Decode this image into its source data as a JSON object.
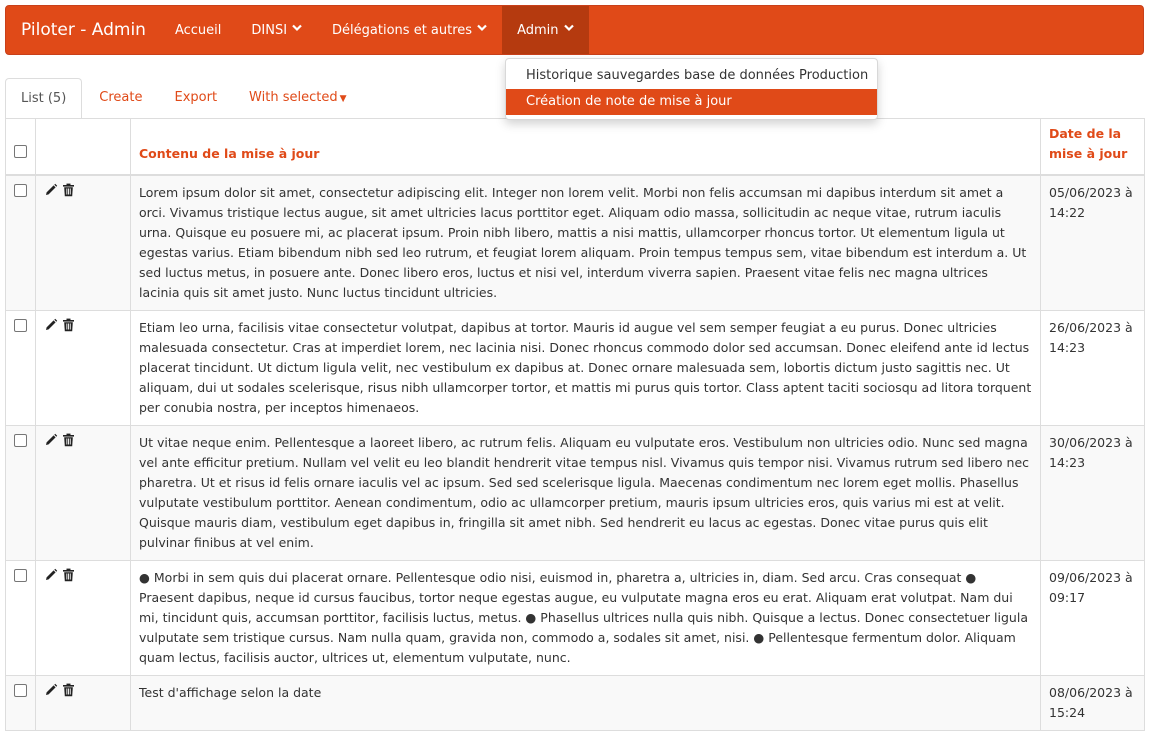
{
  "navbar": {
    "brand": "Piloter - Admin",
    "items": [
      {
        "label": "Accueil",
        "caret": false
      },
      {
        "label": "DINSI",
        "caret": true
      },
      {
        "label": "Délégations et autres",
        "caret": true
      },
      {
        "label": "Admin",
        "caret": true
      }
    ]
  },
  "admin_menu": {
    "items": [
      "Historique sauvegardes base de données Production",
      "Création de note de mise à jour"
    ]
  },
  "tabs": {
    "list": "List (5)",
    "create": "Create",
    "export": "Export",
    "with_selected": "With selected"
  },
  "table": {
    "headers": {
      "content": "Contenu de la mise à jour",
      "date_line1": "Date de la",
      "date_line2": "mise à jour"
    },
    "rows": [
      {
        "content": "Lorem ipsum dolor sit amet, consectetur adipiscing elit. Integer non lorem velit. Morbi non felis accumsan mi dapibus interdum sit amet a orci. Vivamus tristique lectus augue, sit amet ultricies lacus porttitor eget. Aliquam odio massa, sollicitudin ac neque vitae, rutrum iaculis urna. Quisque eu posuere mi, ac placerat ipsum. Proin nibh libero, mattis a nisi mattis, ullamcorper rhoncus tortor. Ut elementum ligula ut egestas varius. Etiam bibendum nibh sed leo rutrum, et feugiat lorem aliquam. Proin tempus tempus sem, vitae bibendum est interdum a. Ut sed luctus metus, in posuere ante. Donec libero eros, luctus et nisi vel, interdum viverra sapien. Praesent vitae felis nec magna ultrices lacinia quis sit amet justo. Nunc luctus tincidunt ultricies.",
        "date": "05/06/2023 à",
        "time": "14:22"
      },
      {
        "content": "Etiam leo urna, facilisis vitae consectetur volutpat, dapibus at tortor. Mauris id augue vel sem semper feugiat a eu purus. Donec ultricies malesuada consectetur. Cras at imperdiet lorem, nec lacinia nisi. Donec rhoncus commodo dolor sed accumsan. Donec eleifend ante id lectus placerat tincidunt. Ut dictum ligula velit, nec vestibulum ex dapibus at. Donec ornare malesuada sem, lobortis dictum justo sagittis nec. Ut aliquam, dui ut sodales scelerisque, risus nibh ullamcorper tortor, et mattis mi purus quis tortor. Class aptent taciti sociosqu ad litora torquent per conubia nostra, per inceptos himenaeos.",
        "date": "26/06/2023 à",
        "time": "14:23"
      },
      {
        "content": "Ut vitae neque enim. Pellentesque a laoreet libero, ac rutrum felis. Aliquam eu vulputate eros. Vestibulum non ultricies odio. Nunc sed magna vel ante efficitur pretium. Nullam vel velit eu leo blandit hendrerit vitae tempus nisl. Vivamus quis tempor nisi. Vivamus rutrum sed libero nec pharetra. Ut et risus id felis ornare iaculis vel ac ipsum. Sed sed scelerisque ligula. Maecenas condimentum nec lorem eget mollis. Phasellus vulputate vestibulum porttitor. Aenean condimentum, odio ac ullamcorper pretium, mauris ipsum ultricies eros, quis varius mi est at velit. Quisque mauris diam, vestibulum eget dapibus in, fringilla sit amet nibh. Sed hendrerit eu lacus ac egestas. Donec vitae purus quis elit pulvinar finibus at vel enim.",
        "date": "30/06/2023 à",
        "time": "14:23"
      },
      {
        "content": "● Morbi in sem quis dui placerat ornare. Pellentesque odio nisi, euismod in, pharetra a, ultricies in, diam. Sed arcu. Cras consequat ● Praesent dapibus, neque id cursus faucibus, tortor neque egestas augue, eu vulputate magna eros eu erat. Aliquam erat volutpat. Nam dui mi, tincidunt quis, accumsan porttitor, facilisis luctus, metus. ● Phasellus ultrices nulla quis nibh. Quisque a lectus. Donec consectetuer ligula vulputate sem tristique cursus. Nam nulla quam, gravida non, commodo a, sodales sit amet, nisi. ● Pellentesque fermentum dolor. Aliquam quam lectus, facilisis auctor, ultrices ut, elementum vulputate, nunc.",
        "date": "09/06/2023 à",
        "time": "09:17"
      },
      {
        "content": "Test d'affichage selon la date",
        "date": "08/06/2023 à",
        "time": "15:24"
      }
    ]
  },
  "colors": {
    "accent": "#e04a18",
    "accent_active": "#b53a0f",
    "row_stripe": "#f9f9f9",
    "border": "#dddddd"
  },
  "icons": {
    "row_actions": [
      "pencil-icon",
      "trash-icon"
    ]
  }
}
